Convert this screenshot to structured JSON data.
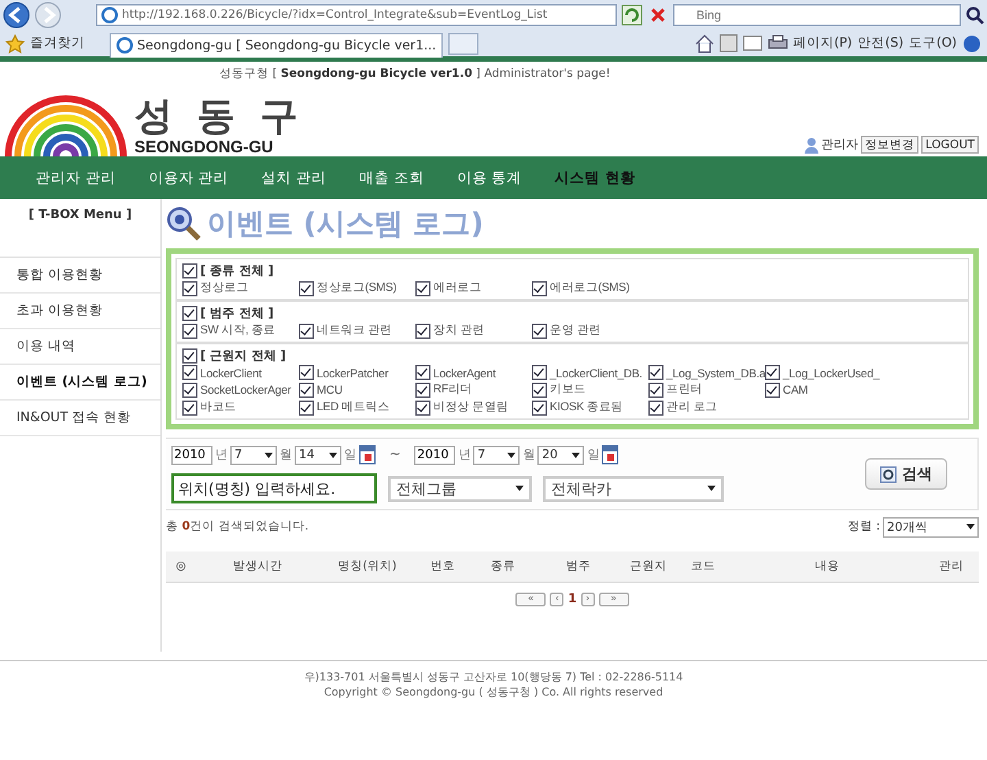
{
  "browser": {
    "url": "http://192.168.0.226/Bicycle/?idx=Control_Integrate&sub=EventLog_List",
    "search_placeholder": "Bing",
    "favorites": "즐겨찾기",
    "tab_title": "Seongdong-gu [ Seongdong-gu Bicycle ver1...",
    "menus": [
      "페이지(P)",
      "안전(S)",
      "도구(O)"
    ]
  },
  "header": {
    "tagline": "성동구청 [ **Seongdong-gu Bicycle ver1.0** ] Administrator's page!",
    "logo_text": "성 동 구",
    "logo_sub": "SEONGDONG-GU",
    "user": "관리자",
    "buttons": [
      "정보변경",
      "LOGOUT"
    ]
  },
  "nav": [
    {
      "label": "관리자 관리",
      "selected": false
    },
    {
      "label": "이용자 관리",
      "selected": false
    },
    {
      "label": "설치 관리",
      "selected": false
    },
    {
      "label": "매출 조회",
      "selected": false
    },
    {
      "label": "이용 통계",
      "selected": false
    },
    {
      "label": "시스템 현황",
      "selected": true
    }
  ],
  "sidebar": {
    "title": "[ T-BOX Menu ]",
    "items": [
      {
        "label": "통합 이용현황",
        "selected": false
      },
      {
        "label": "초과 이용현황",
        "selected": false
      },
      {
        "label": "이용 내역",
        "selected": false
      },
      {
        "label": "이벤트 (시스템 로그)",
        "selected": true
      },
      {
        "label": "IN&OUT 접속 현황",
        "selected": false
      }
    ]
  },
  "page_title": "이벤트 (시스템 로그)",
  "filters": [
    {
      "label": "[ 종류 전체 ]",
      "checked": true,
      "items": [
        {
          "label": "정상로그",
          "checked": true
        },
        {
          "label": "정상로그(SMS)",
          "checked": true
        },
        {
          "label": "에러로그",
          "checked": true
        },
        {
          "label": "에러로그(SMS)",
          "checked": true
        }
      ]
    },
    {
      "label": "[ 범주 전체 ]",
      "checked": true,
      "items": [
        {
          "label": "SW 시작, 종료",
          "checked": true
        },
        {
          "label": "네트워크 관련",
          "checked": true
        },
        {
          "label": "장치 관련",
          "checked": true
        },
        {
          "label": "운영 관련",
          "checked": true
        }
      ]
    },
    {
      "label": "[ 근원지 전체 ]",
      "checked": true,
      "items": [
        {
          "label": "LockerClient",
          "checked": true
        },
        {
          "label": "LockerPatcher",
          "checked": true
        },
        {
          "label": "LockerAgent",
          "checked": true
        },
        {
          "label": "_LockerClient_DB.",
          "checked": true
        },
        {
          "label": "_Log_System_DB.a",
          "checked": true
        },
        {
          "label": "_Log_LockerUsed_",
          "checked": true
        },
        {
          "label": "SocketLockerAger",
          "checked": true
        },
        {
          "label": "MCU",
          "checked": true
        },
        {
          "label": "RF리더",
          "checked": true
        },
        {
          "label": "키보드",
          "checked": true
        },
        {
          "label": "프린터",
          "checked": true
        },
        {
          "label": "CAM",
          "checked": true
        },
        {
          "label": "바코드",
          "checked": true
        },
        {
          "label": "LED 메트릭스",
          "checked": true
        },
        {
          "label": "비정상 문열림",
          "checked": true
        },
        {
          "label": "KIOSK 종료됨",
          "checked": true
        },
        {
          "label": "관리 로그",
          "checked": true
        }
      ]
    }
  ],
  "date_range": [
    {
      "year": "2010",
      "year_unit": "년",
      "month": "7",
      "month_unit": "월",
      "day": "14",
      "day_unit": "일"
    },
    {
      "year": "2010",
      "year_unit": "년",
      "month": "7",
      "month_unit": "월",
      "day": "20",
      "day_unit": "일"
    }
  ],
  "date_separator": "~",
  "location_input": "위치(명칭) 입력하세요.",
  "group_select": "전체그룹",
  "locker_select": "전체락카",
  "search_button": "검색",
  "result_text": "총 **0**건이 검색되었습니다.",
  "sort_label": "정렬 :",
  "sort_select": "20개씩",
  "table": {
    "columns": [
      "◎",
      "발생시간",
      "명칭(위치)",
      "번호",
      "종류",
      "범주",
      "근원지",
      "코드",
      "내용",
      "관리"
    ]
  },
  "pager": {
    "buttons": [
      "«",
      "‹",
      "›",
      "»"
    ],
    "page": "1"
  },
  "footer": [
    "우)133-701 서울특별시 성동구 고산자로 10(행당동 7) Tel : 02-2286-5114",
    "Copyright © Seongdong-gu ( 성동구청 ) Co. All rights reserved"
  ]
}
